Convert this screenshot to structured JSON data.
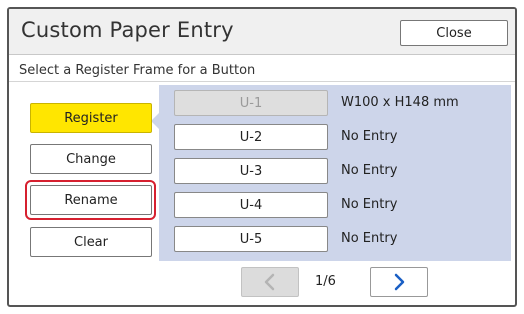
{
  "header": {
    "title": "Custom Paper Entry",
    "close_label": "Close"
  },
  "subtitle": "Select a Register Frame for a Button",
  "actions": [
    {
      "label": "Register",
      "active": true
    },
    {
      "label": "Change",
      "active": false
    },
    {
      "label": "Rename",
      "active": false,
      "highlighted": true
    },
    {
      "label": "Clear",
      "active": false
    }
  ],
  "slots": [
    {
      "label": "U-1",
      "description": "W100 x H148 mm",
      "disabled": true
    },
    {
      "label": "U-2",
      "description": "No Entry",
      "disabled": false
    },
    {
      "label": "U-3",
      "description": "No Entry",
      "disabled": false
    },
    {
      "label": "U-4",
      "description": "No Entry",
      "disabled": false
    },
    {
      "label": "U-5",
      "description": "No Entry",
      "disabled": false
    }
  ],
  "pager": {
    "page_text": "1/6",
    "prev_icon": "chevron-left-icon",
    "next_icon": "chevron-right-icon",
    "prev_enabled": false,
    "next_enabled": true
  },
  "colors": {
    "active_button": "#ffe600",
    "panel": "#cdd5ea",
    "highlight": "#d6202f",
    "next_arrow": "#1a5fc4"
  }
}
